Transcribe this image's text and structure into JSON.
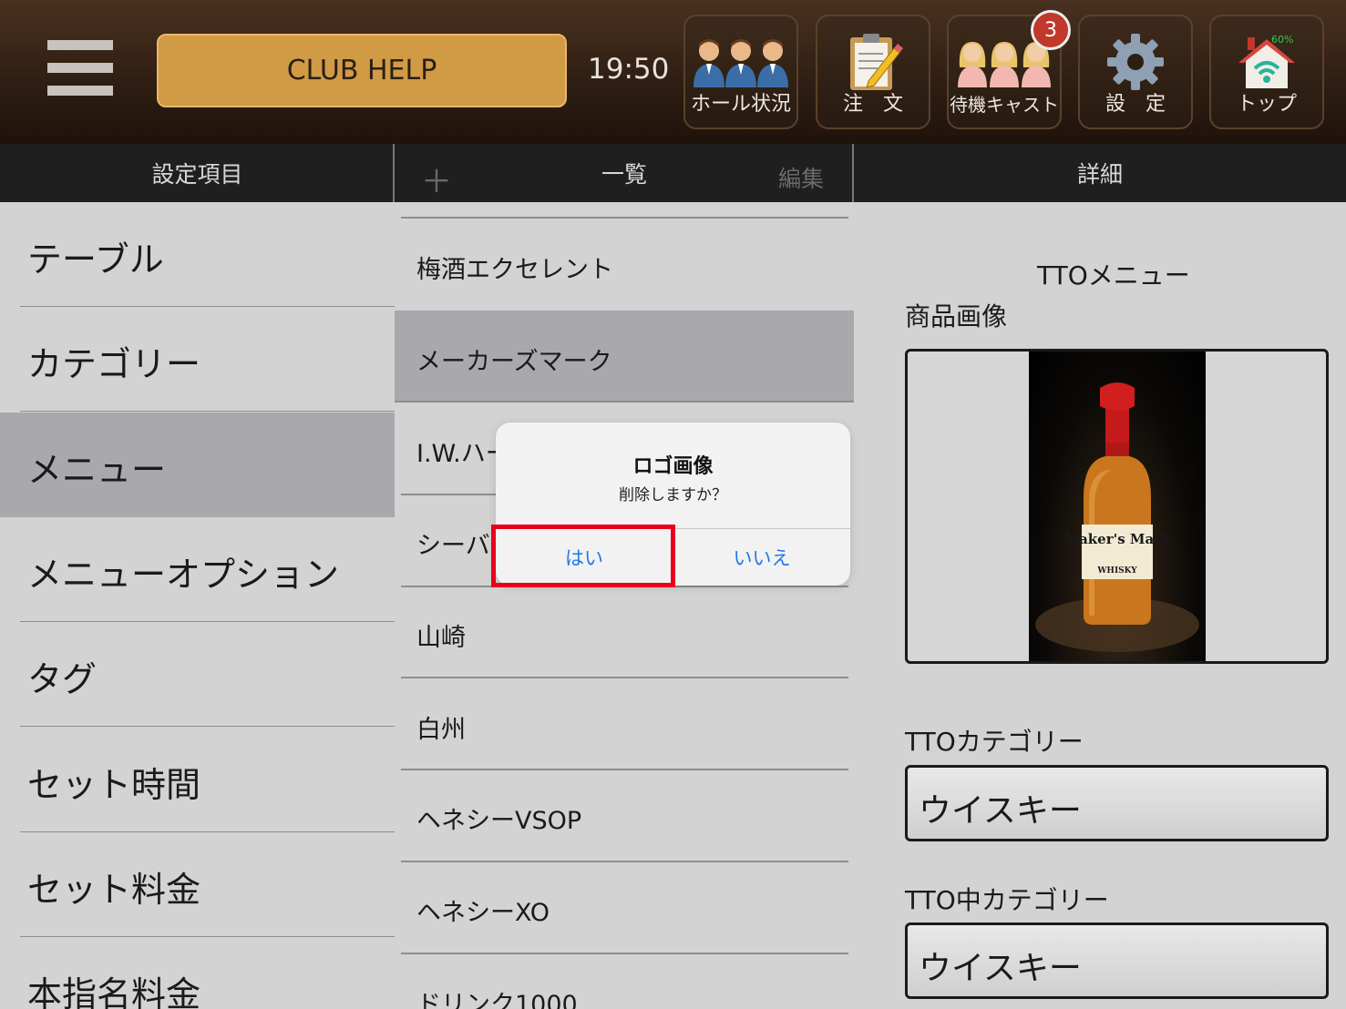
{
  "header": {
    "club_help": "CLUB HELP",
    "time": "19:50",
    "nav": [
      {
        "label": "ホール状況",
        "icon": "staff-group-icon"
      },
      {
        "label": "注　文",
        "icon": "clipboard-pencil-icon"
      },
      {
        "label": "待機キャスト",
        "icon": "cast-group-icon"
      },
      {
        "label": "設　定",
        "icon": "gear-icon"
      },
      {
        "label": "トップ",
        "icon": "home-wifi-icon"
      }
    ],
    "waiting_badge": "3",
    "battery": "60%"
  },
  "columns": {
    "settings": "設定項目",
    "list": "一覧",
    "list_add": "＋",
    "list_edit": "編集",
    "detail": "詳細"
  },
  "settings_items": [
    "テーブル",
    "カテゴリー",
    "メニュー",
    "メニューオプション",
    "タグ",
    "セット時間",
    "セット料金",
    "本指名料金"
  ],
  "selected_setting": "メニュー",
  "menu_items": [
    "梅酒エクセレント",
    "メーカーズマーク",
    "I.W.ハーパー",
    "シーバスリーガル",
    "山崎",
    "白州",
    "ヘネシーVSOP",
    "ヘネシーXO",
    "ドリンク1000"
  ],
  "selected_menu": "メーカーズマーク",
  "detail": {
    "title": "TTOメニュー",
    "image_label": "商品画像",
    "product_brand": "Maker's Mark",
    "product_type": "WHISKY",
    "category_label": "TTOカテゴリー",
    "category_value": "ウイスキー",
    "subcategory_label": "TTO中カテゴリー",
    "subcategory_value": "ウイスキー"
  },
  "dialog": {
    "title": "ロゴ画像",
    "message": "削除しますか？",
    "yes": "はい",
    "no": "いいえ"
  },
  "colors": {
    "accent": "#d19a45",
    "highlight": "#e8001c",
    "selected_row": "#a8a8ad",
    "dialog_button": "#1f7ae0"
  }
}
